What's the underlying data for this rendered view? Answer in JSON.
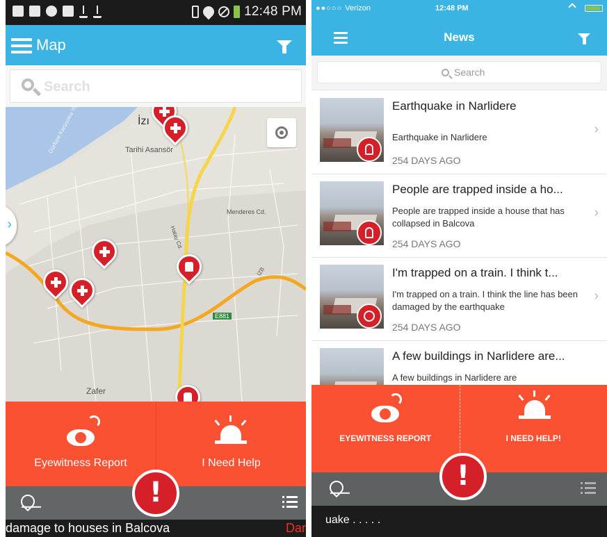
{
  "android": {
    "status_time": "12:48 PM",
    "title": "Map",
    "search_placeholder": "Search",
    "map_labels": {
      "izmir": "İzı",
      "tarihi": "Tarihi Asansör",
      "mendere": "Menderes Cd.",
      "e881": "E881",
      "zafer": "Zafer",
      "yol_left": "Gürlüpe Karşıyaka Yolçu",
      "hatay": "Hatay Cd.",
      "yol_right": "İZB"
    },
    "actions": {
      "eyewitness": "Eyewitness Report",
      "help": "I Need Help"
    },
    "alarm_mark": "!",
    "ticker": "damage to houses in Balcova",
    "ticker_tail": "Dar"
  },
  "ios": {
    "carrier": "Verizon",
    "status_time": "12:48 PM",
    "title": "News",
    "search_placeholder": "Search",
    "news": [
      {
        "title": "Earthquake in Narlidere",
        "desc": "Earthquake in Narlidere",
        "age": "254 DAYS AGO",
        "badge": "people-icon"
      },
      {
        "title": "People are trapped inside a ho...",
        "desc": "People are trapped inside a house that has collapsed in Balcova",
        "age": "254 DAYS AGO",
        "badge": "trapped-icon"
      },
      {
        "title": "I'm trapped on a train. I think t...",
        "desc": "I'm trapped on a train. I think the line has been damaged by the earthquake",
        "age": "254 DAYS AGO",
        "badge": "globe-icon"
      },
      {
        "title": "A few buildings in Narlidere are...",
        "desc": "A few buildings in Narlidere are",
        "age": "",
        "badge": ""
      }
    ],
    "actions": {
      "eyewitness": "EYEWITNESS REPORT",
      "help": "I NEED HELP!"
    },
    "alarm_mark": "!",
    "ticker": "uake . . . . ."
  },
  "colors": {
    "appbar": "#3cb4e3",
    "action": "#fb5133",
    "alarm": "#d5202a",
    "bottom_bar": "#636667",
    "ticker_bg": "#1c1c1c"
  }
}
